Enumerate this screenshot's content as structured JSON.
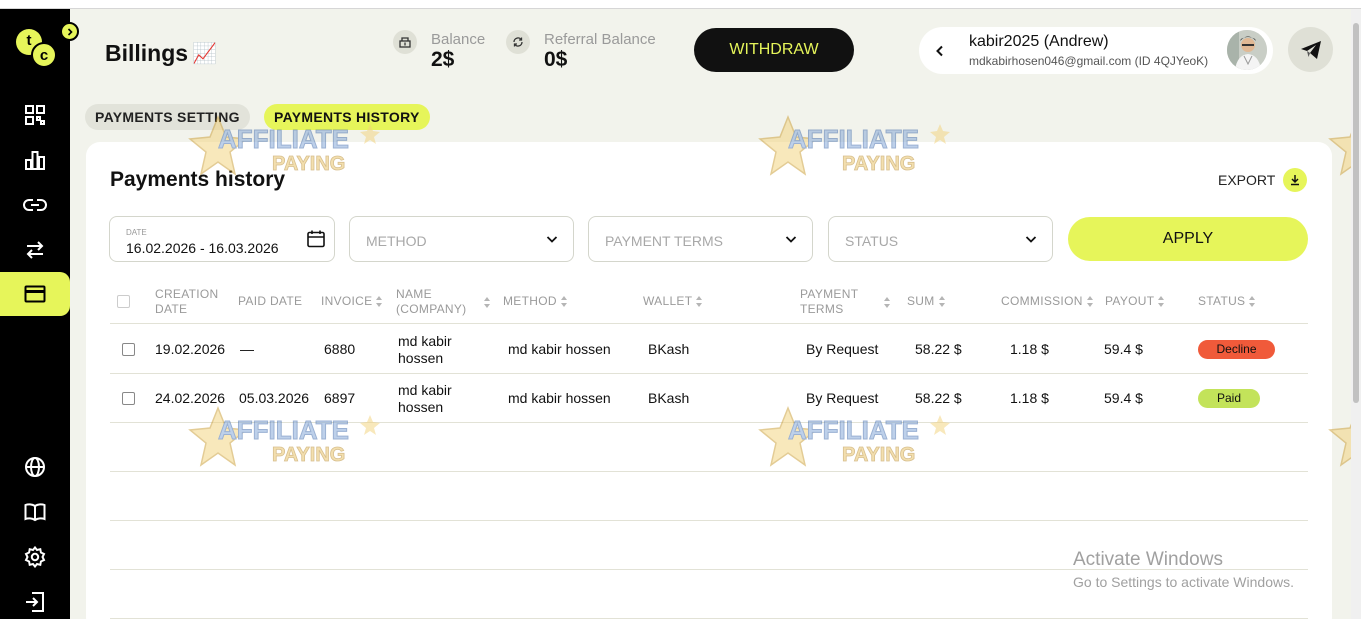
{
  "page": {
    "title": "Billings",
    "title_emoji": "📈"
  },
  "balance": {
    "label": "Balance",
    "value": "2$",
    "referral_label": "Referral Balance",
    "referral_value": "0$"
  },
  "actions": {
    "withdraw_label": "WITHDRAW",
    "export_label": "EXPORT",
    "apply_label": "APPLY"
  },
  "user": {
    "name": "kabir2025 (Andrew)",
    "email": "mdkabirhosen046@gmail.com (ID 4QJYeoK)"
  },
  "tabs": [
    {
      "label": "PAYMENTS SETTING"
    },
    {
      "label": "PAYMENTS HISTORY",
      "active": true
    }
  ],
  "panel": {
    "title": "Payments history"
  },
  "filters": {
    "date_label": "DATE",
    "date_value": "16.02.2026 - 16.03.2026",
    "method_placeholder": "METHOD",
    "terms_placeholder": "PAYMENT TERMS",
    "status_placeholder": "STATUS"
  },
  "table": {
    "columns": {
      "creation_date_1": "CREATION",
      "creation_date_2": "DATE",
      "paid_date": "PAID DATE",
      "invoice": "INVOICE",
      "name_1": "NAME",
      "name_2": "(COMPANY)",
      "method": "METHOD",
      "wallet": "WALLET",
      "terms_1": "PAYMENT",
      "terms_2": "TERMS",
      "sum": "SUM",
      "commission": "COMMISSION",
      "payout": "PAYOUT",
      "status": "STATUS"
    },
    "rows": [
      {
        "creation": "19.02.2026",
        "paid": "—",
        "invoice": "6880",
        "name_1": "md kabir",
        "name_2": "hossen",
        "method": "md kabir hossen",
        "wallet": "BKash",
        "terms": "By Request",
        "sum": "58.22 $",
        "commission": "1.18 $",
        "payout": "59.4 $",
        "status": "Decline"
      },
      {
        "creation": "24.02.2026",
        "paid": "05.03.2026",
        "invoice": "6897",
        "name_1": "md kabir",
        "name_2": "hossen",
        "method": "md kabir hossen",
        "wallet": "BKash",
        "terms": "By Request",
        "sum": "58.22 $",
        "commission": "1.18 $",
        "payout": "59.4 $",
        "status": "Paid"
      }
    ]
  },
  "watermark": {
    "line1": "AFFILIATE",
    "line2": "PAYING"
  },
  "os_notice": {
    "line1": "Activate Windows",
    "line2": "Go to Settings to activate Windows."
  },
  "colors": {
    "accent": "#e6f55a",
    "sidebar": "#000000",
    "decline": "#f05a3a",
    "paid": "#c3e35a"
  }
}
